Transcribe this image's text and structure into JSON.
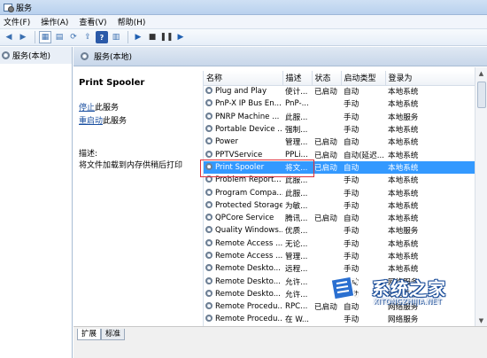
{
  "window": {
    "title": "服务"
  },
  "menu": [
    "文件(F)",
    "操作(A)",
    "查看(V)",
    "帮助(H)"
  ],
  "tree": {
    "root": "服务(本地)"
  },
  "header": {
    "title": "服务(本地)"
  },
  "detail": {
    "service_title": "Print Spooler",
    "stop_link": "停止",
    "stop_suffix": "此服务",
    "restart_link": "重启动",
    "restart_suffix": "此服务",
    "desc_label": "描述:",
    "desc_text": "将文件加载到内存供稍后打印"
  },
  "table": {
    "columns": [
      "名称",
      "描述",
      "状态",
      "启动类型",
      "登录为"
    ],
    "rows": [
      [
        "Plug and Play",
        "使计...",
        "已启动",
        "自动",
        "本地系统"
      ],
      [
        "PnP-X IP Bus En...",
        "PnP-...",
        "",
        "手动",
        "本地系统"
      ],
      [
        "PNRP Machine ...",
        "此服...",
        "",
        "手动",
        "本地服务"
      ],
      [
        "Portable Device ...",
        "强制...",
        "",
        "手动",
        "本地系统"
      ],
      [
        "Power",
        "管理...",
        "已启动",
        "自动",
        "本地系统"
      ],
      [
        "PPTVService",
        "PPLi...",
        "已启动",
        "自动(延迟...",
        "本地系统"
      ],
      [
        "Print Spooler",
        "将文...",
        "已启动",
        "自动",
        "本地系统"
      ],
      [
        "Problem Report...",
        "此服...",
        "",
        "手动",
        "本地系统"
      ],
      [
        "Program Compa...",
        "此服...",
        "",
        "手动",
        "本地系统"
      ],
      [
        "Protected Storage",
        "为敏...",
        "",
        "手动",
        "本地系统"
      ],
      [
        "QPCore Service",
        "腾讯...",
        "已启动",
        "自动",
        "本地系统"
      ],
      [
        "Quality Windows...",
        "优质...",
        "",
        "手动",
        "本地服务"
      ],
      [
        "Remote Access ...",
        "无论...",
        "",
        "手动",
        "本地系统"
      ],
      [
        "Remote Access ...",
        "管理...",
        "",
        "手动",
        "本地系统"
      ],
      [
        "Remote Deskto...",
        "远程...",
        "",
        "手动",
        "本地系统"
      ],
      [
        "Remote Deskto...",
        "允许...",
        "",
        "手动",
        "网络服务"
      ],
      [
        "Remote Deskto...",
        "允许...",
        "",
        "手动",
        "本地系统"
      ],
      [
        "Remote Procedu...",
        "RPC...",
        "已启动",
        "自动",
        "网络服务"
      ],
      [
        "Remote Procedu...",
        "在 W...",
        "",
        "手动",
        "网络服务"
      ]
    ],
    "selected_index": 6
  },
  "tabs": [
    "扩展",
    "标准"
  ],
  "watermark": {
    "brand": "系统之家",
    "url": "XITONGZHIJIA.NET"
  },
  "colors": {
    "selected": "#3399ff",
    "highlight_box": "#e0303a",
    "link": "#1a4fa0"
  }
}
